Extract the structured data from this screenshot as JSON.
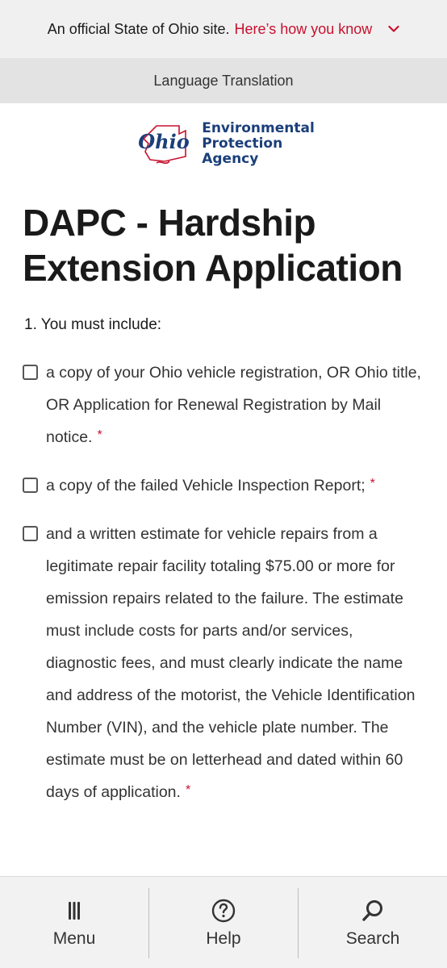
{
  "banner": {
    "official_text": "An official State of Ohio site.",
    "link_text": "Here’s how you know"
  },
  "language": {
    "label": "Language Translation"
  },
  "logo": {
    "script": "Ohio",
    "line1": "Environmental",
    "line2": "Protection",
    "line3": "Agency"
  },
  "page": {
    "title": "DAPC - Hardship Extension Application",
    "question": "1. You must include:"
  },
  "checklist": [
    {
      "text": "a copy of your Ohio vehicle registration, OR Ohio title, OR Application for Renewal Registration by Mail notice.",
      "required": "*"
    },
    {
      "text": "a copy of the failed Vehicle Inspection Report;",
      "required": "*"
    },
    {
      "text": "and a written estimate for vehicle repairs from a legitimate repair facility totaling $75.00 or more for emission repairs related to the failure. The estimate must include costs for parts and/or services, diagnostic fees, and must clearly indicate the name and address of the motorist, the Vehicle Identification Number (VIN), and the vehicle plate number. The estimate must be on letterhead and dated within 60 days of application.",
      "required": "*"
    }
  ],
  "bottom_nav": {
    "menu": {
      "label": "Menu",
      "icon": "menu-icon"
    },
    "help": {
      "label": "Help",
      "icon": "help-icon"
    },
    "search": {
      "label": "Search",
      "icon": "search-icon"
    }
  },
  "colors": {
    "accent_red": "#c8102e",
    "logo_blue": "#1b3f7a"
  }
}
